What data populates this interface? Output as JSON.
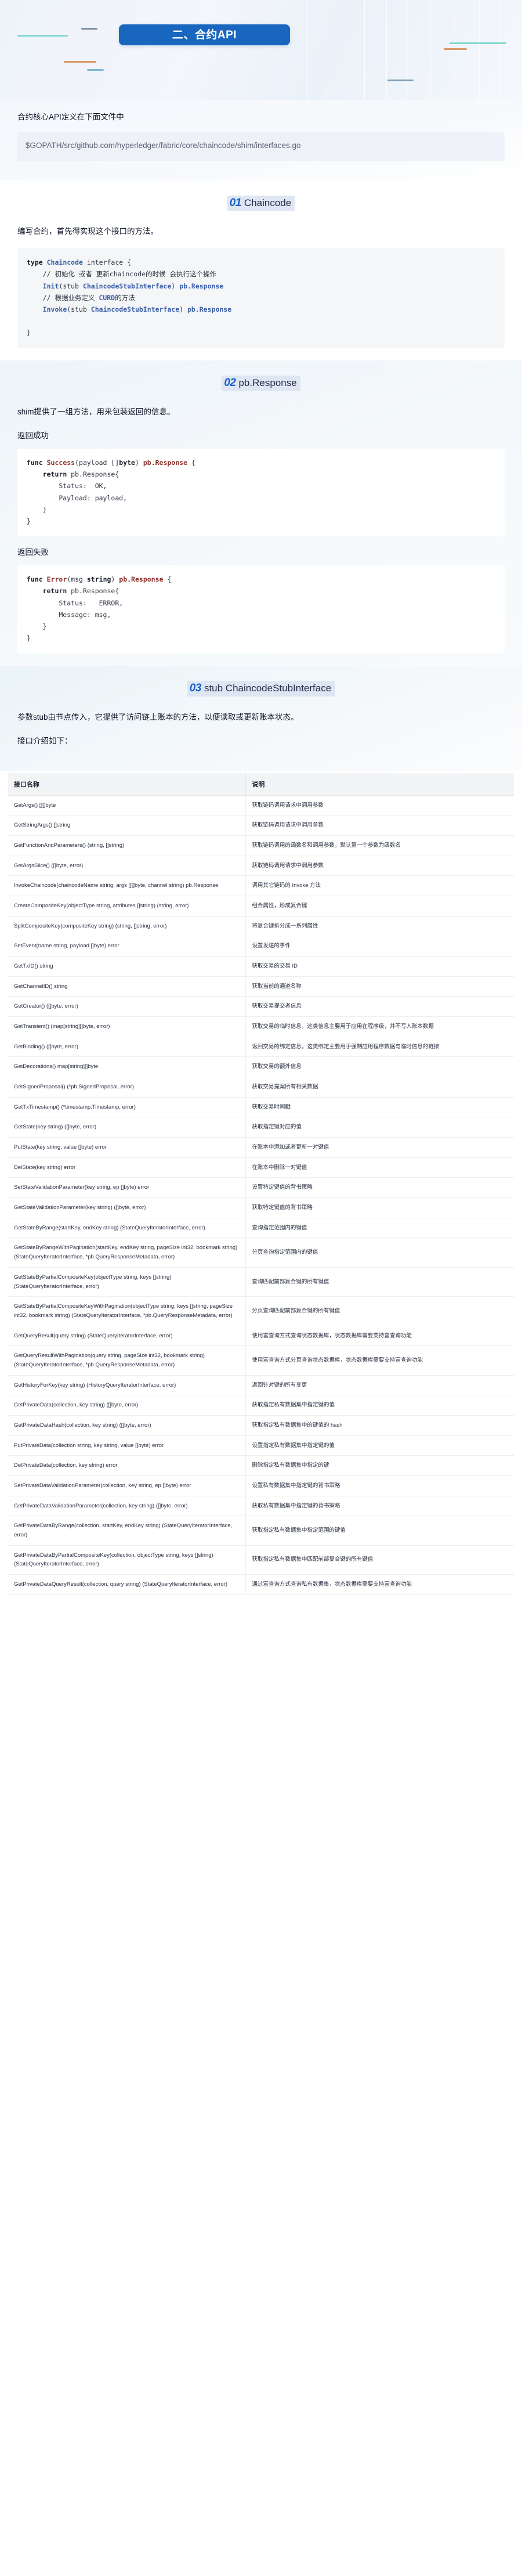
{
  "hero": {
    "banner_title": "二、合约API",
    "banner_color": "#1966bf"
  },
  "intro": {
    "lead": "合约核心API定义在下面文件中",
    "path": "$GOPATH/src/github.com/hyperledger/fabric/core/chaincode/shim/interfaces.go"
  },
  "sections": [
    {
      "num": "01",
      "title": "Chaincode",
      "para": "编写合约，首先得实现这个接口的方法。",
      "code_lines": [
        [
          {
            "t": "type ",
            "c": "k-b"
          },
          {
            "t": "Chaincode",
            "c": "k-blu"
          },
          {
            "t": " interface {",
            "c": "k-pln"
          }
        ],
        [
          {
            "t": "    // 初始化 或者 更新chaincode的时候 会执行这个操作",
            "c": "k-cm"
          }
        ],
        [
          {
            "t": "    ",
            "c": "k-pln"
          },
          {
            "t": "Init",
            "c": "k-blu"
          },
          {
            "t": "(stub ",
            "c": "k-pln"
          },
          {
            "t": "ChaincodeStubInterface",
            "c": "k-blu"
          },
          {
            "t": ") ",
            "c": "k-pln"
          },
          {
            "t": "pb.Response",
            "c": "k-blu"
          }
        ],
        [
          {
            "t": "    // 根据业务定义 ",
            "c": "k-cm"
          },
          {
            "t": "CURD",
            "c": "k-blu"
          },
          {
            "t": "的方法",
            "c": "k-cm"
          }
        ],
        [
          {
            "t": "    ",
            "c": "k-pln"
          },
          {
            "t": "Invoke",
            "c": "k-blu"
          },
          {
            "t": "(stub ",
            "c": "k-pln"
          },
          {
            "t": "ChaincodeStubInterface",
            "c": "k-blu"
          },
          {
            "t": ") ",
            "c": "k-pln"
          },
          {
            "t": "pb.Response",
            "c": "k-blu"
          }
        ],
        [
          {
            "t": "",
            "c": "k-pln"
          }
        ],
        [
          {
            "t": "}",
            "c": "k-pln"
          }
        ]
      ]
    },
    {
      "num": "02",
      "title": "pb.Response",
      "para": "shim提供了一组方法，用来包装返回的信息。",
      "success_label": "返回成功",
      "success_code": [
        [
          {
            "t": "func ",
            "c": "k-b"
          },
          {
            "t": "Success",
            "c": "k-red"
          },
          {
            "t": "(payload []",
            "c": "k-pln"
          },
          {
            "t": "byte",
            "c": "k-b"
          },
          {
            "t": ") ",
            "c": "k-pln"
          },
          {
            "t": "pb.Response",
            "c": "k-red"
          },
          {
            "t": " {",
            "c": "k-pln"
          }
        ],
        [
          {
            "t": "    ",
            "c": "k-pln"
          },
          {
            "t": "return",
            "c": "k-b"
          },
          {
            "t": " pb.Response{",
            "c": "k-pln"
          }
        ],
        [
          {
            "t": "        Status:  OK,",
            "c": "k-pln"
          }
        ],
        [
          {
            "t": "        Payload: payload,",
            "c": "k-pln"
          }
        ],
        [
          {
            "t": "    }",
            "c": "k-pln"
          }
        ],
        [
          {
            "t": "}",
            "c": "k-pln"
          }
        ]
      ],
      "error_label": "返回失败",
      "error_code": [
        [
          {
            "t": "func ",
            "c": "k-b"
          },
          {
            "t": "Error",
            "c": "k-red"
          },
          {
            "t": "(msg ",
            "c": "k-pln"
          },
          {
            "t": "string",
            "c": "k-b"
          },
          {
            "t": ") ",
            "c": "k-pln"
          },
          {
            "t": "pb.Response",
            "c": "k-red"
          },
          {
            "t": " {",
            "c": "k-pln"
          }
        ],
        [
          {
            "t": "    ",
            "c": "k-pln"
          },
          {
            "t": "return",
            "c": "k-b"
          },
          {
            "t": " pb.Response{",
            "c": "k-pln"
          }
        ],
        [
          {
            "t": "        Status:   ERROR,",
            "c": "k-pln"
          }
        ],
        [
          {
            "t": "        Message: msg,",
            "c": "k-pln"
          }
        ],
        [
          {
            "t": "    }",
            "c": "k-pln"
          }
        ],
        [
          {
            "t": "}",
            "c": "k-pln"
          }
        ]
      ]
    },
    {
      "num": "03",
      "title": "stub ChaincodeStubInterface",
      "para": "参数stub由节点传入，它提供了访问链上账本的方法，以便读取或更新账本状态。",
      "para2": "接口介绍如下："
    }
  ],
  "table": {
    "headers": [
      "接口名称",
      "说明"
    ],
    "rows": [
      [
        "GetArgs() [][]byte",
        "获取链码调用请求中调用参数"
      ],
      [
        "GetStringArgs() []string",
        "获取链码调用请求中调用参数"
      ],
      [
        "GetFunctionAndParameters() (string, []string)",
        "获取链码调用的函数名和调用参数，默认第一个参数为函数名"
      ],
      [
        "GetArgsSlice() ([]byte, error)",
        "获取链码调用请求中调用参数"
      ],
      [
        "InvokeChaincode(chaincodeName string, args [][]byte, channel string) pb.Response",
        "调用其它链码的 Invoke 方法"
      ],
      [
        "CreateCompositeKey(objectType string, attributes []string) (string, error)",
        "组合属性，形成复合键"
      ],
      [
        "SplitCompositeKey(compositeKey string) (string, []string, error)",
        "将复合键拆分成一系列属性"
      ],
      [
        "SetEvent(name string, payload []byte) error",
        "设置发送的事件"
      ],
      [
        "GetTxID() string",
        "获取交易的交易 ID"
      ],
      [
        "GetChannelID() string",
        "获取当前的通道名称"
      ],
      [
        "GetCreator() ([]byte, error)",
        "获取交易提交者信息"
      ],
      [
        "GetTransient() (map[string][]byte, error)",
        "获取交易的临时信息，这类信息主要用于应用在程序级，并不写入账本数据"
      ],
      [
        "GetBinding() ([]byte, error)",
        "返回交易的绑定信息，这类绑定主要用于强制应用程序数据与临时信息的链接"
      ],
      [
        "GetDecorations() map[string][]byte",
        "获取交易的额外信息"
      ],
      [
        "GetSignedProposal() (*pb.SignedProposal, error)",
        "获取交易提案所有相关数据"
      ],
      [
        "GetTxTimestamp() (*timestamp.Timestamp, error)",
        "获取交易时间戳"
      ],
      [
        "GetState(key string) ([]byte, error)",
        "获取指定键对应的值"
      ],
      [
        "PutState(key string, value []byte) error",
        "在账本中添加或者更新一对键值"
      ],
      [
        "DelState(key string) error",
        "在账本中删除一对键值"
      ],
      [
        "SetStateValidationParameter(key string, ep []byte) error",
        "设置特定键值的背书策略"
      ],
      [
        "GetStateValidationParameter(key string) ([]byte, error)",
        "获取特定键值的背书策略"
      ],
      [
        "GetStateByRange(startKey, endKey string) (StateQueryIteratorInterface, error)",
        "查询指定范围内的键值"
      ],
      [
        "GetStateByRangeWithPagination(startKey, endKey string, pageSize int32, bookmark string) (StateQueryIteratorInterface, *pb.QueryResponseMetadata, error)",
        "分页查询指定范围内的键值"
      ],
      [
        "GetStateByPartialCompositeKey(objectType string, keys []string) (StateQueryIteratorInterface, error)",
        "查询匹配前部复合键的所有键值"
      ],
      [
        "GetStateByPartialCompositeKeyWithPagination(objectType string, keys []string, pageSize int32, bookmark string) (StateQueryIteratorInterface, *pb.QueryResponseMetadata, error)",
        "分页查询匹配前部复合键的所有键值"
      ],
      [
        "GetQueryResult(query string) (StateQueryIteratorInterface, error)",
        "使用富查询方式查询状态数据库，状态数据库需要支持富查询功能"
      ],
      [
        "GetQueryResultWithPagination(query string, pageSize int32, bookmark string) (StateQueryIteratorInterface, *pb.QueryResponseMetadata, error)",
        "使用富查询方式分页查询状态数据库，状态数据库需要支持富查询功能"
      ],
      [
        "GetHistoryForKey(key string) (HistoryQueryIteratorInterface, error)",
        "返回针对键的所有变更"
      ],
      [
        "GetPrivateData(collection, key string) ([]byte, error)",
        "获取指定私有数据集中指定键的值"
      ],
      [
        "GetPrivateDataHash(collection, key string) ([]byte, error)",
        "获取指定私有数据集中的键值的 hash"
      ],
      [
        "PutPrivateData(collection string, key string, value []byte) error",
        "设置指定私有数据集中指定键的值"
      ],
      [
        "DelPrivateData(collection, key string) error",
        "删除指定私有数据集中指定的键"
      ],
      [
        "SetPrivateDataValidationParameter(collection, key string, ep []byte) error",
        "设置私有数据集中指定键的背书策略"
      ],
      [
        "GetPrivateDataValidationParameter(collection, key string) ([]byte, error)",
        "获取私有数据集中指定键的背书策略"
      ],
      [
        "GetPrivateDataByRange(collection, startKey, endKey string) (StateQueryIteratorInterface, error)",
        "获取指定私有数据集中指定范围的键值"
      ],
      [
        "GetPrivateDataByPartialCompositeKey(collection, objectType string, keys []string) (StateQueryIteratorInterface, error)",
        "获取指定私有数据集中匹配前部复合键的所有键值"
      ],
      [
        "GetPrivateDataQueryResult(collection, query string) (StateQueryIteratorInterface, error)",
        "通过富查询方式查询私有数据集，状态数据库需要支持富查询功能"
      ]
    ]
  }
}
